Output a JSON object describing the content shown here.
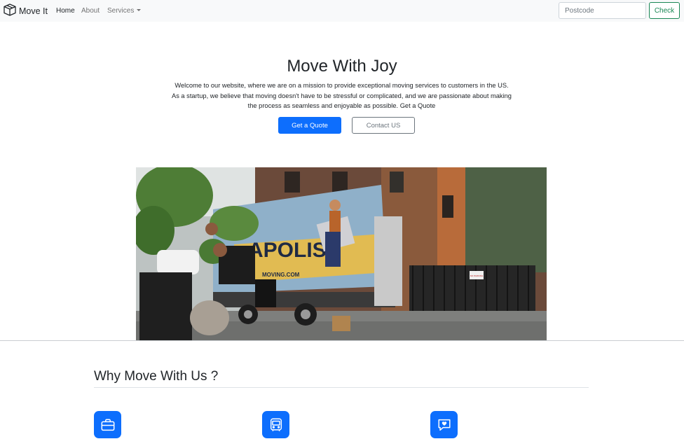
{
  "navbar": {
    "brand": "Move It",
    "brand_icon": "box-icon",
    "links": [
      {
        "label": "Home",
        "active": true
      },
      {
        "label": "About",
        "active": false
      },
      {
        "label": "Services",
        "active": false,
        "dropdown": true
      }
    ],
    "search": {
      "placeholder": "Postcode",
      "value": ""
    },
    "check_label": "Check"
  },
  "hero": {
    "title": "Move With Joy",
    "text": "Welcome to our website, where we are on a mission to provide exceptional moving services to customers in the US. As a startup, we believe that moving doesn't have to be stressful or complicated, and we are passionate about making the process as seamless and enjoyable as possible. Get a Quote",
    "primary_button": "Get a Quote",
    "secondary_button": "Contact US",
    "image": {
      "truck_text": "APOLIS",
      "truck_subtext": "MOVING.COM",
      "sign_text": "NO PARKING"
    }
  },
  "features": {
    "title": "Why Move With Us ?",
    "icons": [
      "briefcase-icon",
      "bus-icon",
      "chat-heart-icon"
    ]
  },
  "colors": {
    "primary": "#0d6efd",
    "success": "#198754",
    "secondary": "#6c757d",
    "navbar_bg": "#f8f9fa"
  }
}
